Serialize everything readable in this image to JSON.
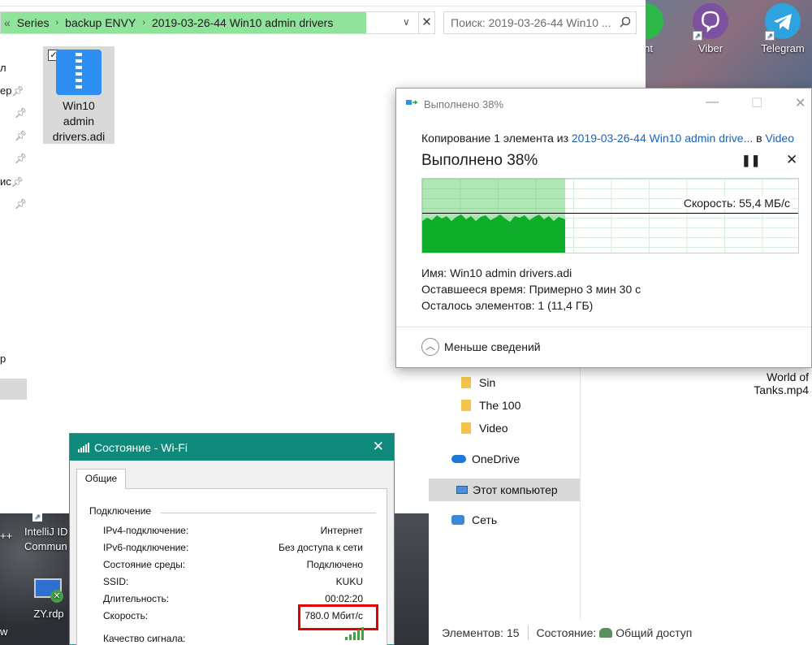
{
  "explorer": {
    "breadcrumbs": [
      "«",
      "Series",
      "backup ENVY",
      "2019-03-26-44 Win10 admin drivers"
    ],
    "search_placeholder": "Поиск: 2019-03-26-44 Win10 ...",
    "nav_fragments": [
      "л",
      "ер",
      "ис",
      "р"
    ],
    "file": {
      "name": "Win10 admin drivers.adi",
      "checked": "✓"
    }
  },
  "desktop": {
    "icons": [
      {
        "label": "ent",
        "color": "#2fb84a"
      },
      {
        "label": "Viber",
        "color": "#7d51a0"
      },
      {
        "label": "Telegram",
        "color": "#2ea3dd"
      },
      {
        "label": "IntelliJ ID Commun",
        "color": "#000000"
      },
      {
        "label": "ZY.rdp",
        "color": "#2f6fd1"
      }
    ],
    "left_fragments": [
      "++",
      "w"
    ]
  },
  "copy_dialog": {
    "title": "Выполнено 38%",
    "from_prefix": "Копирование 1 элемента из ",
    "from_link": "2019-03-26-44 Win10 admin drive...",
    "to_word": " в ",
    "to_link": "Video",
    "percent_text": "Выполнено 38%",
    "progress": 0.38,
    "speed": "Скорость: 55,4 МБ/с",
    "name_label": "Имя:",
    "name_value": "Win10 admin drivers.adi",
    "time_label": "Оставшееся время:",
    "time_value": "Примерно 3 мин 30 с",
    "items_label": "Осталось элементов:",
    "items_value": "1 (11,4 ГБ)",
    "less_details": "Меньше сведений"
  },
  "explorer2": {
    "nav": [
      {
        "label": "Sin",
        "icon": "folder-icon"
      },
      {
        "label": "The 100",
        "icon": "folder-icon"
      },
      {
        "label": "Video",
        "icon": "folder-icon"
      },
      {
        "label": "OneDrive",
        "icon": "cloud-icon"
      },
      {
        "label": "Этот компьютер",
        "icon": "computer-icon"
      },
      {
        "label": "Сеть",
        "icon": "network-icon"
      }
    ],
    "file_label": "World of Tanks.mp4",
    "status_count": "Элементов: 15",
    "status_state": "Состояние:",
    "status_share": "Общий доступ"
  },
  "wifi_dialog": {
    "title": "Состояние - Wi-Fi",
    "tab": "Общие",
    "group": "Подключение",
    "rows": [
      {
        "label": "IPv4-подключение:",
        "value": "Интернет"
      },
      {
        "label": "IPv6-подключение:",
        "value": "Без доступа к сети"
      },
      {
        "label": "Состояние среды:",
        "value": "Подключено"
      },
      {
        "label": "SSID:",
        "value": "KUKU"
      },
      {
        "label": "Длительность:",
        "value": "00:02:20"
      },
      {
        "label": "Скорость:",
        "value": "780.0 Мбит/с"
      }
    ],
    "signal_label": "Качество сигнала:",
    "signal_level": 5,
    "signal_max": 5,
    "signal_color": "#3fa63f"
  }
}
